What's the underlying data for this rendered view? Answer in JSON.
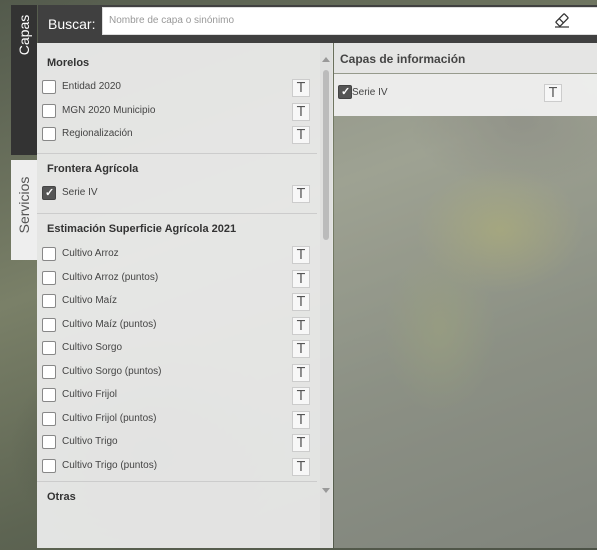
{
  "search": {
    "label": "Buscar:",
    "placeholder": "Nombre de capa o sinónimo"
  },
  "tabs": {
    "capas": "Capas",
    "servicios": "Servicios"
  },
  "layer_groups": [
    {
      "title": "Morelos",
      "items": [
        {
          "label": "Entidad 2020",
          "checked": false
        },
        {
          "label": "MGN 2020 Municipio",
          "checked": false
        },
        {
          "label": "Regionalización",
          "checked": false
        }
      ]
    },
    {
      "title": "Frontera Agrícola",
      "items": [
        {
          "label": "Serie IV",
          "checked": true
        }
      ]
    },
    {
      "title": "Estimación Superficie Agrícola 2021",
      "items": [
        {
          "label": "Cultivo Arroz",
          "checked": false
        },
        {
          "label": "Cultivo Arroz (puntos)",
          "checked": false
        },
        {
          "label": "Cultivo Maíz",
          "checked": false
        },
        {
          "label": "Cultivo Maíz (puntos)",
          "checked": false
        },
        {
          "label": "Cultivo Sorgo",
          "checked": false
        },
        {
          "label": "Cultivo Sorgo (puntos)",
          "checked": false
        },
        {
          "label": "Cultivo Frijol",
          "checked": false
        },
        {
          "label": "Cultivo Frijol (puntos)",
          "checked": false
        },
        {
          "label": "Cultivo Trigo",
          "checked": false
        },
        {
          "label": "Cultivo Trigo (puntos)",
          "checked": false
        }
      ]
    },
    {
      "title": "Otras",
      "items": []
    }
  ],
  "table_button_glyph": "T",
  "info_panel": {
    "title": "Capas de información",
    "items": [
      {
        "label": "Serie IV",
        "checked": true
      }
    ]
  },
  "icons": {
    "eraser": "eraser-icon",
    "close": "close-icon"
  }
}
